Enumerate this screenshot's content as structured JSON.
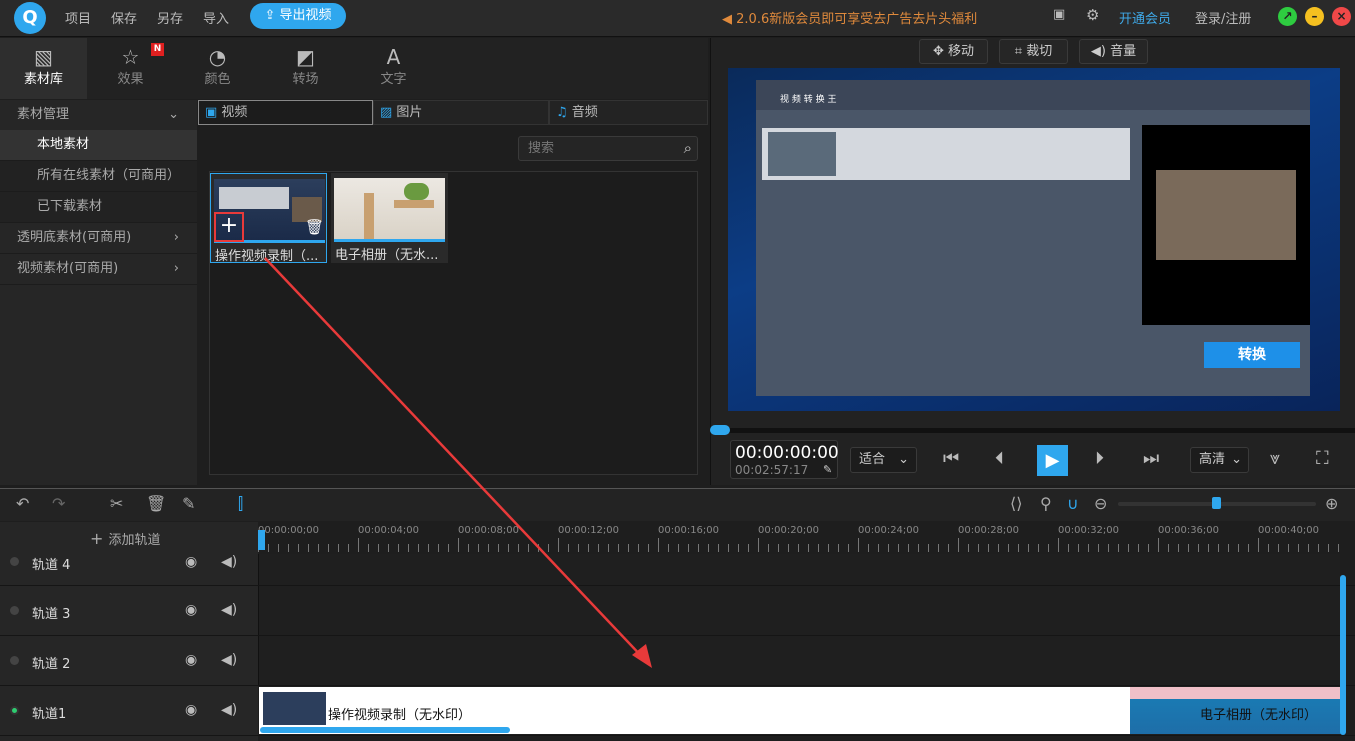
{
  "topbar": {
    "menu": [
      "项目",
      "保存",
      "另存",
      "导入"
    ],
    "export": "导出视频",
    "promo": "2.0.6新版会员即可享受去广告去片头福利",
    "vip": "开通会员",
    "login": "登录/注册"
  },
  "tabs": [
    {
      "label": "素材库",
      "icon": "photos-icon"
    },
    {
      "label": "效果",
      "icon": "magic-icon",
      "badge": "N"
    },
    {
      "label": "颜色",
      "icon": "palette-icon"
    },
    {
      "label": "转场",
      "icon": "transition-icon"
    },
    {
      "label": "文字",
      "icon": "text-icon"
    }
  ],
  "sidebar": {
    "items": [
      "素材管理",
      "本地素材",
      "所有在线素材（可商用）",
      "已下载素材",
      "透明底素材(可商用)",
      "视频素材(可商用)"
    ]
  },
  "media": {
    "tabs": [
      "视频",
      "图片",
      "音频"
    ],
    "search_placeholder": "搜索",
    "items": [
      "操作视频录制（...",
      "电子相册（无水..."
    ]
  },
  "preview": {
    "buttons": [
      "移动",
      "裁切",
      "音量"
    ],
    "convert_label": "转换",
    "app_title": "视 频 转 换 王",
    "time_current": "00:00:00:00",
    "time_total": "00:02:57:17",
    "fit": "适合",
    "quality": "高清",
    "progress": 0
  },
  "timeline": {
    "add_track": "添加轨道",
    "ruler": [
      "00:00:00;00",
      "00:00:04;00",
      "00:00:08;00",
      "00:00:12;00",
      "00:00:16;00",
      "00:00:20;00",
      "00:00:24;00",
      "00:00:28;00",
      "00:00:32;00",
      "00:00:36;00",
      "00:00:40;00"
    ],
    "tracks": [
      "轨道 4",
      "轨道 3",
      "轨道 2",
      "轨道1"
    ],
    "clips": [
      "操作视频录制（无水印）",
      "电子相册（无水印）"
    ]
  },
  "colors": {
    "accent": "#2fa7ee",
    "promo": "#e08a3c",
    "arrow": "#e83a3a"
  }
}
